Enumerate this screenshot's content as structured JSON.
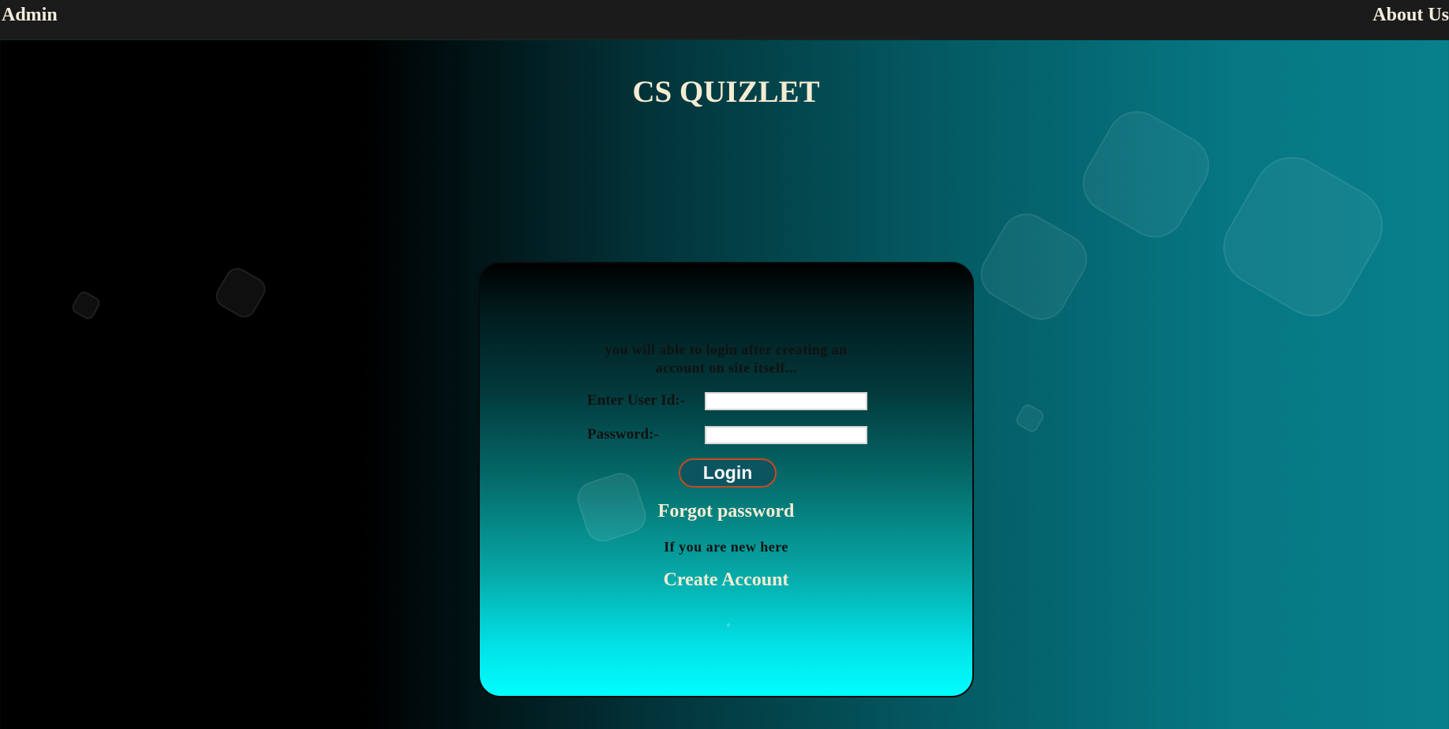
{
  "nav": {
    "admin_label": "Admin",
    "about_label": "About Us"
  },
  "header": {
    "title": "CS QUIZLET"
  },
  "login": {
    "note_line1": "you will able to login after creating an",
    "note_line2": "account on site itself...",
    "user_label": "Enter User Id:-",
    "user_value": "",
    "password_label": "Password:-",
    "password_value": "",
    "login_button": "Login",
    "forgot_password": "Forgot password",
    "new_here_text": "If you are new here",
    "create_account": "Create Account"
  },
  "colors": {
    "topbar": "#1c1b1b",
    "title_text": "#f6ecd2",
    "login_button_border": "#c74a21",
    "login_button_bg": "#0b5560",
    "card_top": "#000000",
    "card_bottom": "#00ffff"
  }
}
